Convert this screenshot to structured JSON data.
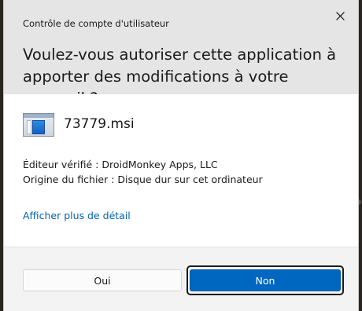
{
  "dialog": {
    "caption": "Contrôle de compte d'utilisateur",
    "question": "Voulez-vous autoriser cette application à apporter des modifications à votre appareil ?",
    "close_icon": "close-icon"
  },
  "program": {
    "icon": "installer-package-icon",
    "filename": "73779.msi",
    "publisher": "Éditeur vérifié : DroidMonkey Apps, LLC",
    "origin": "Origine du fichier : Disque dur sur cet ordinateur",
    "details_link": "Afficher plus de détail"
  },
  "buttons": {
    "yes_label": "Oui",
    "no_label": "Non"
  },
  "colors": {
    "accent": "#0067c0",
    "link": "#0063b1",
    "header_bg": "#e5e5e5"
  }
}
